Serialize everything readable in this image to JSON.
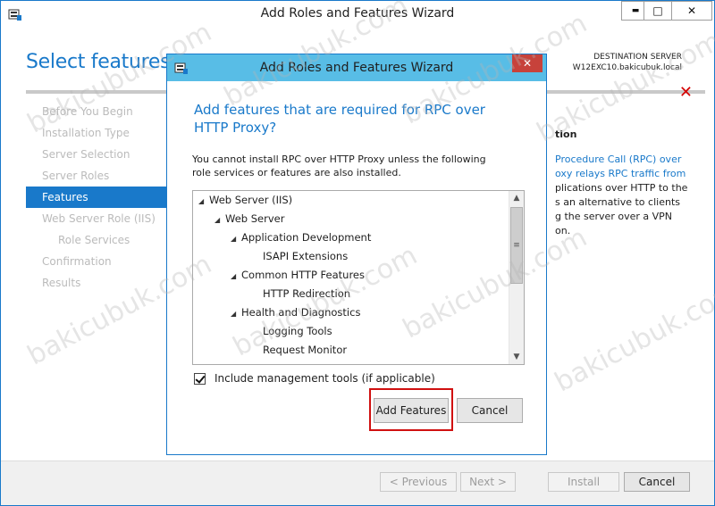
{
  "main_window": {
    "title": "Add Roles and Features Wizard",
    "minimize_glyph": "▬",
    "maximize_glyph": "□",
    "close_glyph": "✕",
    "page_title": "Select features",
    "destination_label": "DESTINATION SERVER",
    "destination_server": "W12EXC10.bakicubuk.local",
    "nav_items": [
      {
        "label": "Before You Begin",
        "state": "normal"
      },
      {
        "label": "Installation Type",
        "state": "normal"
      },
      {
        "label": "Server Selection",
        "state": "normal"
      },
      {
        "label": "Server Roles",
        "state": "normal"
      },
      {
        "label": "Features",
        "state": "active"
      },
      {
        "label": "Web Server Role (IIS)",
        "state": "normal"
      },
      {
        "label": "Role Services",
        "state": "sub"
      },
      {
        "label": "Confirmation",
        "state": "normal"
      },
      {
        "label": "Results",
        "state": "normal"
      }
    ],
    "description_heading": "tion",
    "description_lines": [
      "Procedure Call (RPC) over",
      "oxy relays RPC traffic from",
      "plications over HTTP to the",
      "s an alternative to clients",
      "g the server over a VPN",
      "on."
    ],
    "footer": {
      "previous_label": "< Previous",
      "next_label": "Next >",
      "install_label": "Install",
      "cancel_label": "Cancel"
    },
    "error_icon_glyph": "✕"
  },
  "dialog": {
    "title": "Add Roles and Features Wizard",
    "close_glyph": "✕",
    "heading": "Add features that are required for RPC over HTTP Proxy?",
    "message": "You cannot install RPC over HTTP Proxy unless the following role services or features are also installed.",
    "tree": [
      {
        "label": "Web Server (IIS)",
        "level": 0,
        "expanded": true
      },
      {
        "label": "Web Server",
        "level": 1,
        "expanded": true
      },
      {
        "label": "Application Development",
        "level": 2,
        "expanded": true
      },
      {
        "label": "ISAPI Extensions",
        "level": 3,
        "expanded": false
      },
      {
        "label": "Common HTTP Features",
        "level": 2,
        "expanded": true
      },
      {
        "label": "HTTP Redirection",
        "level": 3,
        "expanded": false
      },
      {
        "label": "Health and Diagnostics",
        "level": 2,
        "expanded": true
      },
      {
        "label": "Logging Tools",
        "level": 3,
        "expanded": false
      },
      {
        "label": "Request Monitor",
        "level": 3,
        "expanded": false
      }
    ],
    "include_tools_label": "Include management tools (if applicable)",
    "include_tools_checked": true,
    "add_features_label": "Add Features",
    "cancel_label": "Cancel"
  },
  "watermark_text": "bakicubuk.com",
  "colors": {
    "accent": "#1979ca",
    "dialog_titlebar": "#58bde6",
    "highlight": "#d01010"
  }
}
